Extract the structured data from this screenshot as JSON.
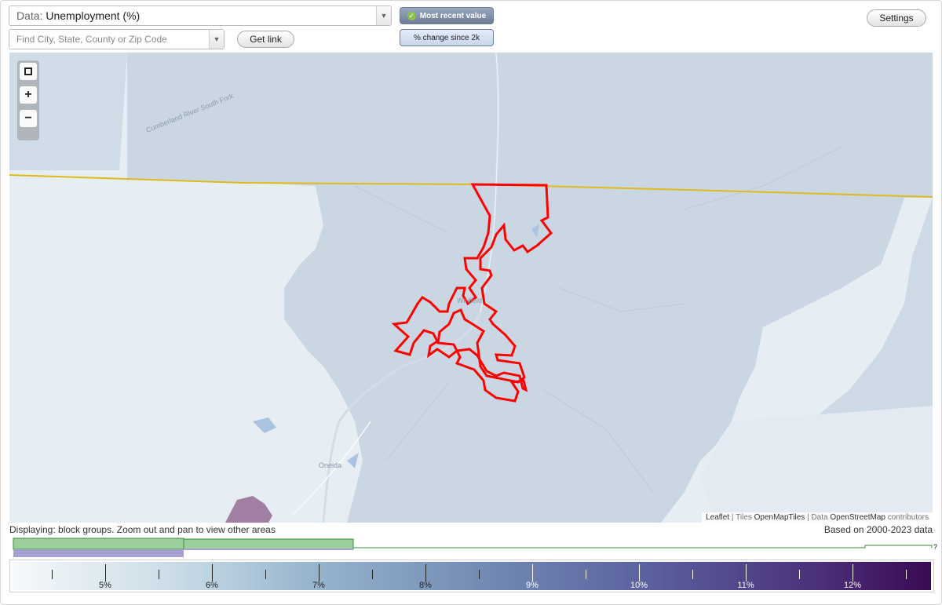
{
  "controls": {
    "data_label": "Data:",
    "data_value": "Unemployment (%)",
    "search_placeholder": "Find City, State, County or Zip Code",
    "get_link": "Get link",
    "mode_active": "Most recent value",
    "mode_inactive": "% change since 2k",
    "settings": "Settings"
  },
  "map": {
    "labels": {
      "river": "Cumberland River South Fork",
      "winfield": "Winfield",
      "oneida": "Oneida"
    },
    "attribution": {
      "leaflet": "Leaflet",
      "tiles_prefix": "Tiles",
      "tiles": "OpenMapTiles",
      "data_prefix": "Data",
      "osm": "OpenStreetMap",
      "suffix": "contributors"
    },
    "highlight_color": "#ff0000",
    "state_line_color": "#e0b91a"
  },
  "status": {
    "displaying": "Displaying: block groups. Zoom out and pan to view other areas",
    "based_on": "Based on 2000-2023 data"
  },
  "histogram": {
    "unknown_marker": "?"
  },
  "legend": {
    "ticks": [
      "5%",
      "6%",
      "7%",
      "8%",
      "9%",
      "10%",
      "11%",
      "12%"
    ],
    "color_low": "#f6f9fb",
    "color_high": "#3a0a52"
  }
}
